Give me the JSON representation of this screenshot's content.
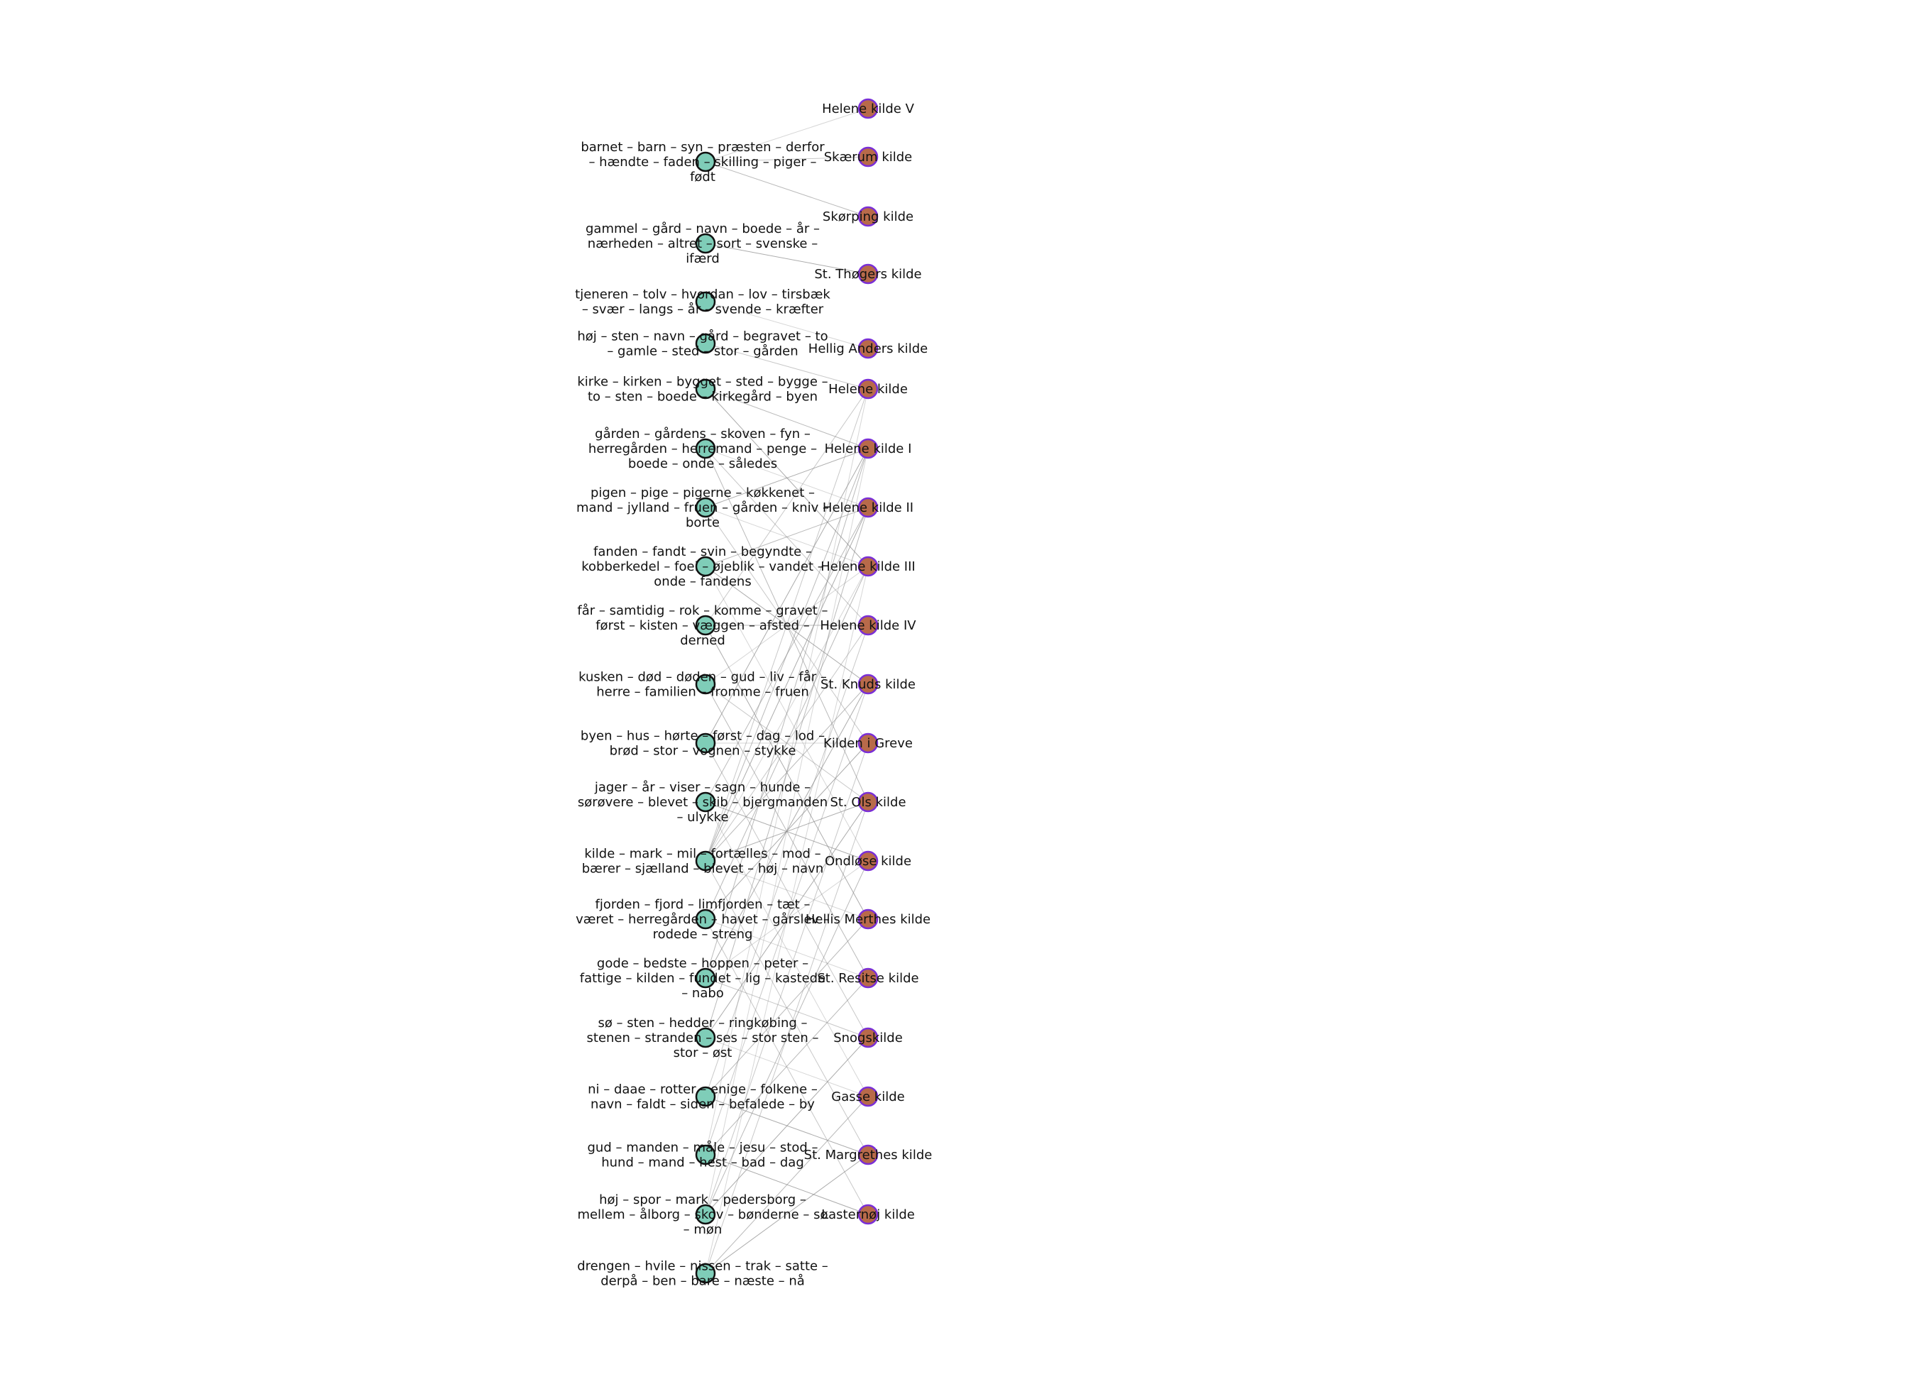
{
  "colors": {
    "topic_fill": "#7fcdb8",
    "topic_stroke": "#111111",
    "source_fill": "#b86a4a",
    "source_stroke": "#7a2fd6",
    "edge": "#8a8a8a",
    "label": "#111111"
  },
  "topics": [
    {
      "id": "t1",
      "lines": [
        "barnet – barn – syn – præsten – derfor",
        "– hændte – faden – skilling – piger –",
        "født"
      ]
    },
    {
      "id": "t2",
      "lines": [
        "gammel – gård – navn – boede – år –",
        "nærheden – altret – sort – svenske –",
        "ifærd"
      ]
    },
    {
      "id": "t3",
      "lines": [
        "tjeneren – tolv – hvordan – lov – tirsbæk",
        "– svær – langs – år – svende – kræfter"
      ]
    },
    {
      "id": "t4",
      "lines": [
        "høj – sten – navn – gård – begravet – to",
        "– gamle – sted – stor – gården"
      ]
    },
    {
      "id": "t5",
      "lines": [
        "kirke – kirken – bygget – sted – bygge –",
        "to – sten – boede – kirkegård – byen"
      ]
    },
    {
      "id": "t6",
      "lines": [
        "gården – gårdens – skoven – fyn –",
        "herregården – herremand – penge –",
        "boede – onde – således"
      ]
    },
    {
      "id": "t7",
      "lines": [
        "pigen – pige – pigerne – køkkenet –",
        "mand – jylland – fruen – gården – kniv –",
        "borte"
      ]
    },
    {
      "id": "t8",
      "lines": [
        "fanden – fandt – svin – begyndte –",
        "kobberkedel – foei – øjeblik – vandet –",
        "onde – fandens"
      ]
    },
    {
      "id": "t9",
      "lines": [
        "får – samtidig – rok – komme – gravet –",
        "først – kisten – væggen – afsted –",
        "derned"
      ]
    },
    {
      "id": "t10",
      "lines": [
        "kusken – død – døden – gud – liv – får –",
        "herre – familien – fromme – fruen"
      ]
    },
    {
      "id": "t11",
      "lines": [
        "byen – hus – hørte – først – dag – lod –",
        "brød – stor – vognen – stykke"
      ]
    },
    {
      "id": "t12",
      "lines": [
        "jager – år – viser – sagn – hunde –",
        "sørøvere – blevet – skib – bjergmanden",
        "– ulykke"
      ]
    },
    {
      "id": "t13",
      "lines": [
        "kilde – mark – mil – fortælles – mod –",
        "bærer – sjælland – blevet – høj – navn"
      ]
    },
    {
      "id": "t14",
      "lines": [
        "fjorden – fjord – limfjorden – tæt –",
        "været – herregården – havet – gårslev –",
        "rodede – streng"
      ]
    },
    {
      "id": "t15",
      "lines": [
        "gode – bedste – hoppen – peter –",
        "fattige – kilden – fundet – lig – kastede",
        "– nabo"
      ]
    },
    {
      "id": "t16",
      "lines": [
        "sø – sten – hedder – ringkøbing –",
        "stenen – stranden – ses – stor sten –",
        "stor – øst"
      ]
    },
    {
      "id": "t17",
      "lines": [
        "ni – daae – rotter – enige – folkene –",
        "navn – faldt – siden – befalede – by"
      ]
    },
    {
      "id": "t18",
      "lines": [
        "gud – manden – måle – jesu – stod –",
        "hund – mand – hest – bad – dag"
      ]
    },
    {
      "id": "t19",
      "lines": [
        "høj – spor – mark – pedersborg –",
        "mellem – ålborg – skov – bønderne – sø",
        "– møn"
      ]
    },
    {
      "id": "t20",
      "lines": [
        "drengen – hvile – nissen – trak – satte –",
        "derpå – ben – bare – næste – nå"
      ]
    }
  ],
  "sources": [
    {
      "id": "s1",
      "label": "Helene kilde V"
    },
    {
      "id": "s2",
      "label": "Skærum kilde"
    },
    {
      "id": "s3",
      "label": "Skørping kilde"
    },
    {
      "id": "s4",
      "label": "St. Thøgers kilde"
    },
    {
      "id": "s5",
      "label": "Hellig Anders kilde"
    },
    {
      "id": "s6",
      "label": "Helene kilde"
    },
    {
      "id": "s7",
      "label": "Helene kilde I"
    },
    {
      "id": "s8",
      "label": "Helene kilde II"
    },
    {
      "id": "s9",
      "label": "Helene kilde III"
    },
    {
      "id": "s10",
      "label": "Helene kilde IV"
    },
    {
      "id": "s11",
      "label": "St. Knuds kilde"
    },
    {
      "id": "s12",
      "label": "Kilden i Greve"
    },
    {
      "id": "s13",
      "label": "St. Ols kilde"
    },
    {
      "id": "s14",
      "label": "Ondløse kilde"
    },
    {
      "id": "s15",
      "label": "Hellis Merthes kilde"
    },
    {
      "id": "s16",
      "label": "St. Resitse kilde"
    },
    {
      "id": "s17",
      "label": "Snogskilde"
    },
    {
      "id": "s18",
      "label": "Gasse kilde"
    },
    {
      "id": "s19",
      "label": "St. Margrethes kilde"
    },
    {
      "id": "s20",
      "label": "Lasternøj kilde"
    }
  ],
  "edges": [
    [
      "t1",
      "s1"
    ],
    [
      "t1",
      "s2"
    ],
    [
      "t1",
      "s3"
    ],
    [
      "t2",
      "s4"
    ],
    [
      "t3",
      "s5"
    ],
    [
      "t4",
      "s6"
    ],
    [
      "t5",
      "s7"
    ],
    [
      "t5",
      "s9"
    ],
    [
      "t6",
      "s8"
    ],
    [
      "t6",
      "s10"
    ],
    [
      "t6",
      "s13"
    ],
    [
      "t7",
      "s7"
    ],
    [
      "t7",
      "s9"
    ],
    [
      "t7",
      "s12"
    ],
    [
      "t8",
      "s8"
    ],
    [
      "t8",
      "s11"
    ],
    [
      "t8",
      "s14"
    ],
    [
      "t9",
      "s6"
    ],
    [
      "t9",
      "s10"
    ],
    [
      "t9",
      "s15"
    ],
    [
      "t10",
      "s9"
    ],
    [
      "t10",
      "s13"
    ],
    [
      "t10",
      "s16"
    ],
    [
      "t11",
      "s7"
    ],
    [
      "t11",
      "s12"
    ],
    [
      "t11",
      "s17"
    ],
    [
      "t12",
      "s8"
    ],
    [
      "t12",
      "s14"
    ],
    [
      "t12",
      "s18"
    ],
    [
      "t13",
      "s6"
    ],
    [
      "t13",
      "s7"
    ],
    [
      "t13",
      "s8"
    ],
    [
      "t13",
      "s9"
    ],
    [
      "t13",
      "s10"
    ],
    [
      "t13",
      "s11"
    ],
    [
      "t13",
      "s13"
    ],
    [
      "t13",
      "s15"
    ],
    [
      "t13",
      "s19"
    ],
    [
      "t14",
      "s9"
    ],
    [
      "t14",
      "s12"
    ],
    [
      "t14",
      "s16"
    ],
    [
      "t14",
      "s20"
    ],
    [
      "t15",
      "s7"
    ],
    [
      "t15",
      "s11"
    ],
    [
      "t15",
      "s14"
    ],
    [
      "t15",
      "s17"
    ],
    [
      "t16",
      "s8"
    ],
    [
      "t16",
      "s13"
    ],
    [
      "t16",
      "s18"
    ],
    [
      "t17",
      "s10"
    ],
    [
      "t17",
      "s15"
    ],
    [
      "t17",
      "s19"
    ],
    [
      "t18",
      "s6"
    ],
    [
      "t18",
      "s11"
    ],
    [
      "t18",
      "s16"
    ],
    [
      "t18",
      "s20"
    ],
    [
      "t19",
      "s7"
    ],
    [
      "t19",
      "s12"
    ],
    [
      "t19",
      "s14"
    ],
    [
      "t19",
      "s17"
    ],
    [
      "t20",
      "s9"
    ],
    [
      "t20",
      "s13"
    ],
    [
      "t20",
      "s18"
    ],
    [
      "t20",
      "s19"
    ]
  ]
}
